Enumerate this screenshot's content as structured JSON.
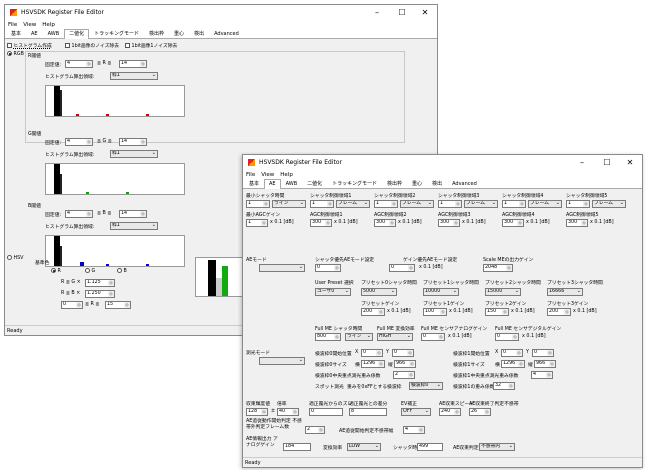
{
  "w1": {
    "title": "HSVSDK Register File Editor",
    "menu": [
      "File",
      "View",
      "Help"
    ],
    "tabs": [
      "基本",
      "AE",
      "AWB",
      "二値化",
      "トラッキングモード",
      "検出枠",
      "重心",
      "検出",
      "Advanced"
    ],
    "active_tab": 3,
    "hist_label": "ヒストグラム作成",
    "opt1": "1bit画像のノイズ除去",
    "opt2": "1bit画像1ノイズ除去",
    "rgb": "RGB",
    "r": {
      "title": "R閾値",
      "fixed": "固定値:",
      "lo": "4",
      "op": "≦ R ≦",
      "hi": "14",
      "calc": "ヒストグラム算出領域:",
      "frame": "枠1"
    },
    "g": {
      "title": "G閾値",
      "fixed": "固定値:",
      "lo": "4",
      "op": "≦ G ≦",
      "hi": "14",
      "calc": "ヒストグラム算出領域:",
      "frame": "枠1"
    },
    "b": {
      "title": "B閾値",
      "fixed": "固定値:",
      "lo": "4",
      "op": "≦ B ≦",
      "hi": "14",
      "calc": "ヒストグラム算出領域:",
      "frame": "枠1"
    },
    "hsv": "HSV",
    "base": "基準色",
    "rb": "R",
    "gb": "G",
    "bb": "B",
    "rg_label": "R ≦ G ×",
    "rg_val": "1.125",
    "rb_label": "R ≦ B ×",
    "rb_val": "1.250",
    "lo2": "0",
    "op2": "≦ R ≦",
    "hi2": "15",
    "status": "Ready"
  },
  "w2": {
    "title": "HSVSDK Register File Editor",
    "menu": [
      "File",
      "View",
      "Help"
    ],
    "tabs": [
      "基本",
      "AE",
      "AWB",
      "二値化",
      "トラッキングモード",
      "検出枠",
      "重心",
      "検出",
      "Advanced"
    ],
    "active_tab": 1,
    "shutter": [
      {
        "label": "最小シャッタ時間",
        "v1": "1",
        "v2": "ライン"
      },
      {
        "label": "シャッタ制御領域1",
        "v1": "1",
        "v2": "フレーム"
      },
      {
        "label": "シャッタ制御領域2",
        "v1": "1",
        "v2": "フレーム"
      },
      {
        "label": "シャッタ制御領域3",
        "v1": "1",
        "v2": "フレーム"
      },
      {
        "label": "シャッタ制御領域4",
        "v1": "1",
        "v2": "フレーム"
      },
      {
        "label": "シャッタ制御領域5",
        "v1": "1",
        "v2": "フレーム"
      }
    ],
    "agc": [
      {
        "label": "最小AGCゲイン",
        "v": "1",
        "u": "x 0.1 [dB]"
      },
      {
        "label": "AGC制御領域1",
        "v": "300",
        "u": "x 0.1 [dB]"
      },
      {
        "label": "AGC制御領域2",
        "v": "300",
        "u": "x 0.1 [dB]"
      },
      {
        "label": "AGC制御領域3",
        "v": "300",
        "u": "x 0.1 [dB]"
      },
      {
        "label": "AGC制御領域4",
        "v": "300",
        "u": "x 0.1 [dB]"
      },
      {
        "label": "AGC制御領域5",
        "v": "300",
        "u": "x 0.1 [dB]"
      }
    ],
    "ae_mode": "AEモード",
    "shutter_prio": "シャッタ優先AEモード設定",
    "shutter_prio_v": "0",
    "gain_prio": "ゲイン優先AEモード設定",
    "gain_prio_v": "0",
    "gain_prio_u": "x 0.1 [dB]",
    "scale_me": "Scale MEの出力ゲイン",
    "scale_me_v": "2048",
    "user_preset": "User Preset 選択",
    "user_preset_v": "ユーザ0",
    "preset_sh": [
      {
        "label": "プリセット0シャッタ時間",
        "v": "5000"
      },
      {
        "label": "プリセット1シャッタ時間",
        "v": "10000"
      },
      {
        "label": "プリセット2シャッタ時間",
        "v": "15000"
      },
      {
        "label": "プリセット3シャッタ時間",
        "v": "16666"
      }
    ],
    "preset_gain": [
      {
        "label": "プリセットゲイン",
        "v": "200"
      },
      {
        "label": "プリセット1ゲイン",
        "v": "100"
      },
      {
        "label": "プリセット2ゲイン",
        "v": "150"
      },
      {
        "label": "プリセット3ゲイン",
        "v": "200"
      }
    ],
    "preset_unit": "x 0.1 [dB]",
    "fullme_sh": "Full ME シャッタ時間",
    "fullme_sh_v": "800",
    "fullme_sh_u": "ライン",
    "fullme_conv": "Full ME 変換効率",
    "fullme_conv_v": "HIGH",
    "fullme_ana": "Full ME センサアナログゲイン",
    "fullme_ana_v": "0",
    "fullme_ana_u": "x 0.1 [dB]",
    "fullme_dig": "Full ME センサデジタルゲイン",
    "fullme_dig_v": "0",
    "fullme_dig_u": "x 0.1 [dB]",
    "meter_mode": "測光モード",
    "det_start": "検波枠0開始位置",
    "det_x": "0",
    "det_y": "0",
    "det_size": "検波枠0サイズ",
    "det_w": "1296",
    "det_h": "966",
    "det_weight": "検波枠0中央重点測光重み係数",
    "det_weight_v": "2",
    "spot": "スポット測光",
    "spot_w": "重みを0xFFとする検波枠",
    "spot_v": "検波枠0",
    "det1_start": "検波枠1開始位置",
    "det1_x": "0",
    "det1_y": "0",
    "det1_size": "検波枠1サイズ",
    "det1_w": "1296",
    "det1_h": "966",
    "det1_weight": "検波枠1中央重点測光重み係数",
    "det1_weight_v": "4",
    "det1_w2": "検波枠1の重み係数",
    "det1_w2_v": "32",
    "target": "収束輝度値",
    "target_v": "128",
    "ratio": "倍率",
    "ratio_v": "40",
    "tol": "適正露光からのズレ",
    "tol_v": "0",
    "tol2": "適正露光との差分",
    "tol2_v": "8",
    "ev": "EV補正",
    "ev_v": "OFF",
    "speed": "AE収束スピード",
    "speed_v": "240",
    "stop": "AE収束終了判定不感帯",
    "stop_v": "26",
    "start": "AE追従動作開始判定 不感帯外判定フレーム数",
    "start_v": "2",
    "start2": "AE追従開始判定不感帯幅",
    "start2_v": "4",
    "ana_out": "AE情報出力 アナログゲイン",
    "ana_out_v": "184",
    "conv": "変換効率",
    "conv_v": "LOW",
    "sh_out": "シャッタ時間",
    "sh_out_v": "499",
    "judge": "AE収束判定",
    "judge_v": "不感帯内",
    "status": "Ready"
  }
}
